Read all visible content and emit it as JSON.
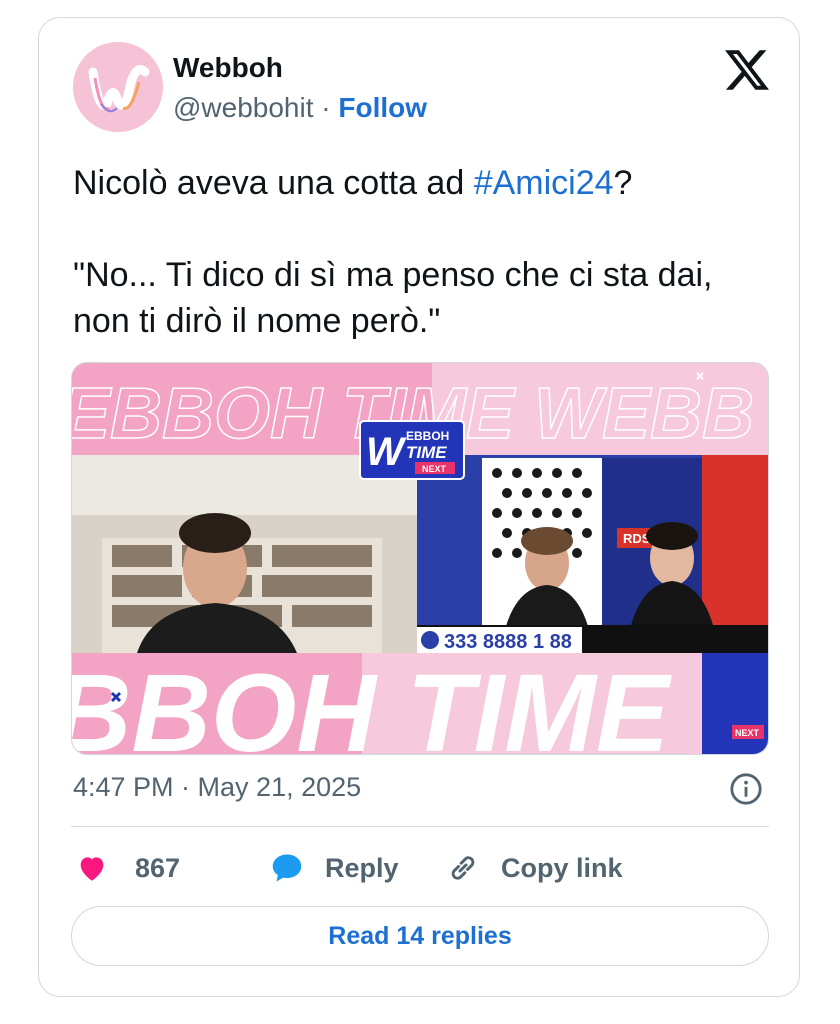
{
  "author": {
    "name": "Webboh",
    "handle": "@webbohit",
    "separator": "·",
    "follow_label": "Follow",
    "avatar_letter": "W"
  },
  "tweet": {
    "line1_prefix": "Nicolò aveva una cotta ad ",
    "hashtag": "#Amici24",
    "line1_suffix": "?",
    "quote": "\"No... Ti dico di sì ma penso che ci sta dai,\nnon ti dirò il nome però.\""
  },
  "media": {
    "banner_top": "EBBOH TIME WEBB",
    "banner_bottom": "BBOH TIME",
    "logo_letter": "W",
    "logo_line1": "EBBOH",
    "logo_line2": "TIME",
    "logo_line3": "NEXT",
    "phone_number": "333 8888 1 88",
    "rds_label": "RDS",
    "corner_badge": "NEXT"
  },
  "meta": {
    "timestamp": "4:47 PM · May 21, 2025"
  },
  "actions": {
    "likes": "867",
    "reply_label": "Reply",
    "copy_link_label": "Copy link"
  },
  "read_replies_label": "Read 14 replies",
  "colors": {
    "accent": "#1d6fd1",
    "like": "#f91880",
    "reply_bubble": "#1d9bf0",
    "muted": "#536471",
    "border": "#cfd9de"
  },
  "icons": [
    "x-logo-icon",
    "info-icon",
    "heart-icon",
    "reply-bubble-icon",
    "link-icon"
  ]
}
